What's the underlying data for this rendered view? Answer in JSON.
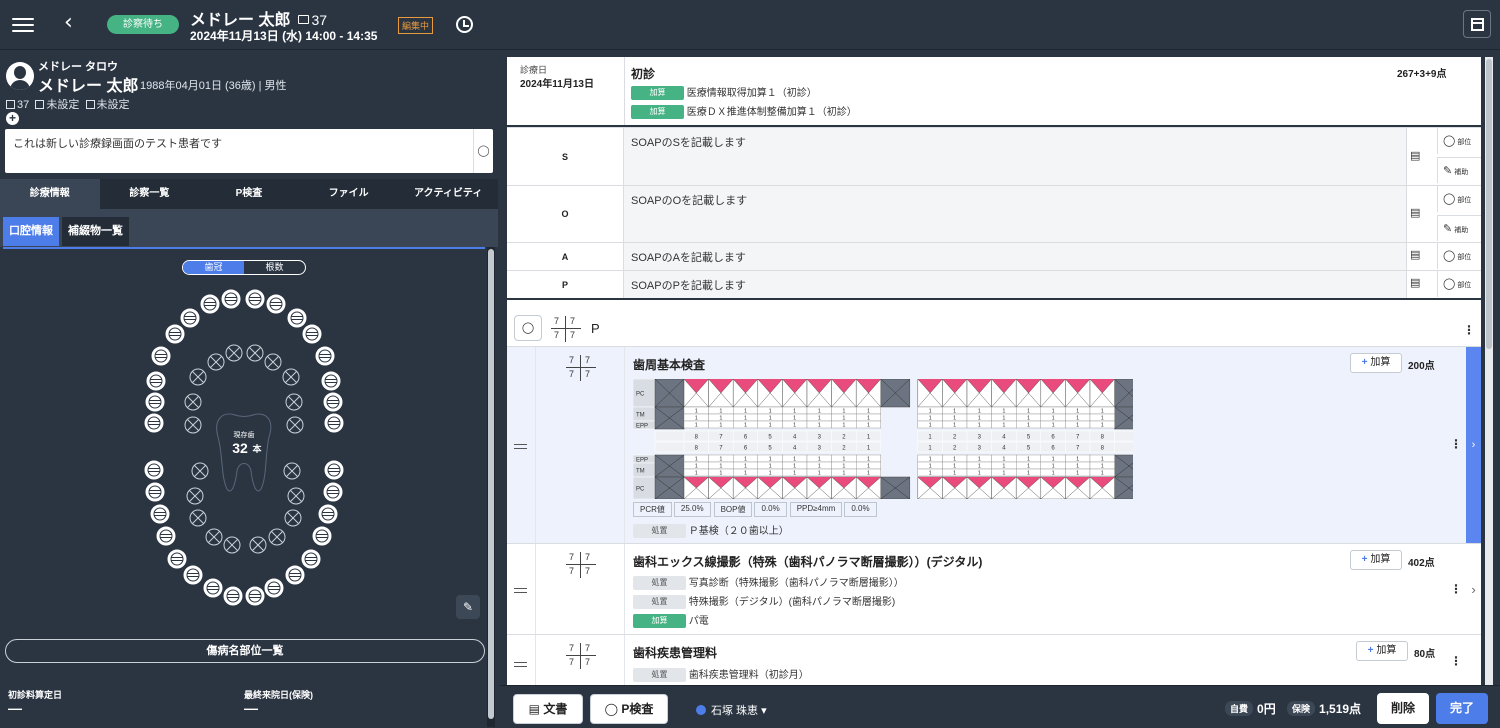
{
  "topbar": {
    "status": "診察待ち",
    "patient_name": "メドレー 太郎",
    "patient_id": "37",
    "datetime": "2024年11月13日 (水) 14:00 - 14:35",
    "edit_badge": "編集中",
    "icons": [
      "menu-icon",
      "back-icon",
      "clock-icon",
      "layout-icon"
    ]
  },
  "patient": {
    "kana": "メドレー タロウ",
    "name": "メドレー 太郎",
    "info": "1988年04月01日 (36歳) | 男性",
    "id": "37",
    "meta1": "未設定",
    "meta2": "未設定",
    "memo": "これは新しい診療録画面のテスト患者です"
  },
  "left_tabs": [
    "診療情報",
    "診察一覧",
    "P検査",
    "ファイル",
    "アクティビティ"
  ],
  "left_subtabs": [
    "口腔情報",
    "補綴物一覧"
  ],
  "dental": {
    "toggle": [
      "歯冠",
      "根数"
    ],
    "remaining_label": "現存歯",
    "remaining_count": "32",
    "remaining_unit": "本"
  },
  "disease_button": "傷病名部位一覧",
  "footer": {
    "first_visit_label": "初診料算定日",
    "first_visit_value": "—",
    "last_visit_label": "最終来院日(保険)",
    "last_visit_value": "—"
  },
  "record": {
    "visit_label": "診療日",
    "visit_date": "2024年11月13日",
    "first_visit": "初診",
    "first_points": "267+3+9点",
    "add_tag": "加算",
    "proc_tag": "処置",
    "first_lines": [
      "医療情報取得加算１（初診）",
      "医療ＤＸ推進体制整備加算１（初診）"
    ],
    "soap": [
      {
        "label": "S",
        "text": "SOAPのSを記載します"
      },
      {
        "label": "O",
        "text": "SOAPのOを記載します"
      },
      {
        "label": "A",
        "text": "SOAPのAを記載します"
      },
      {
        "label": "P",
        "text": "SOAPのPを記載します"
      }
    ],
    "tool_site": "部位",
    "tool_assist": "補助",
    "tooth_header": "P",
    "formula": [
      "7",
      "7",
      "7",
      "7"
    ],
    "add_button": "加算",
    "procedures": [
      {
        "title": "歯周基本検査",
        "points": "200点",
        "chart": {
          "row_labels": [
            "PC",
            "TM",
            "EPP",
            "EPP",
            "TM",
            "PC"
          ],
          "upper_right": [
            "8",
            "7",
            "6",
            "5",
            "4",
            "3",
            "2",
            "1"
          ],
          "upper_left": [
            "1",
            "2",
            "3",
            "4",
            "5",
            "6",
            "7",
            "8"
          ],
          "pocket_value": "1"
        },
        "stats": [
          {
            "label": "PCR値",
            "value": "25.0%"
          },
          {
            "label": "BOP値",
            "value": "0.0%"
          },
          {
            "label": "PPD≥4mm",
            "value": "0.0%"
          }
        ],
        "sub": [
          {
            "tag": "処置",
            "text": "Ｐ基検（２０歯以上）"
          }
        ]
      },
      {
        "title": "歯科エックス線撮影（特殊（歯科パノラマ断層撮影））(デジタル)",
        "points": "402点",
        "sub": [
          {
            "tag": "処置",
            "text": "写真診断（特殊撮影（歯科パノラマ断層撮影））"
          },
          {
            "tag": "処置",
            "text": "特殊撮影（デジタル）(歯科パノラマ断層撮影)"
          },
          {
            "tag": "加算",
            "text": "パ電"
          }
        ]
      },
      {
        "title": "歯科疾患管理料",
        "points": "80点",
        "sub": [
          {
            "tag": "処置",
            "text": "歯科疾患管理料（初診月）"
          }
        ]
      }
    ]
  },
  "bottombar": {
    "doc_button": "文書",
    "p_button": "P検査",
    "doctor": "石塚 珠恵",
    "self_pay_label": "自費",
    "self_pay": "0円",
    "insurance_label": "保険",
    "insurance": "1,519点",
    "delete": "削除",
    "complete": "完了"
  },
  "colors": {
    "accent": "#4d7de9",
    "status_green": "#46b384",
    "panel_dark": "#2b3542",
    "pink": "#e94b7c"
  }
}
